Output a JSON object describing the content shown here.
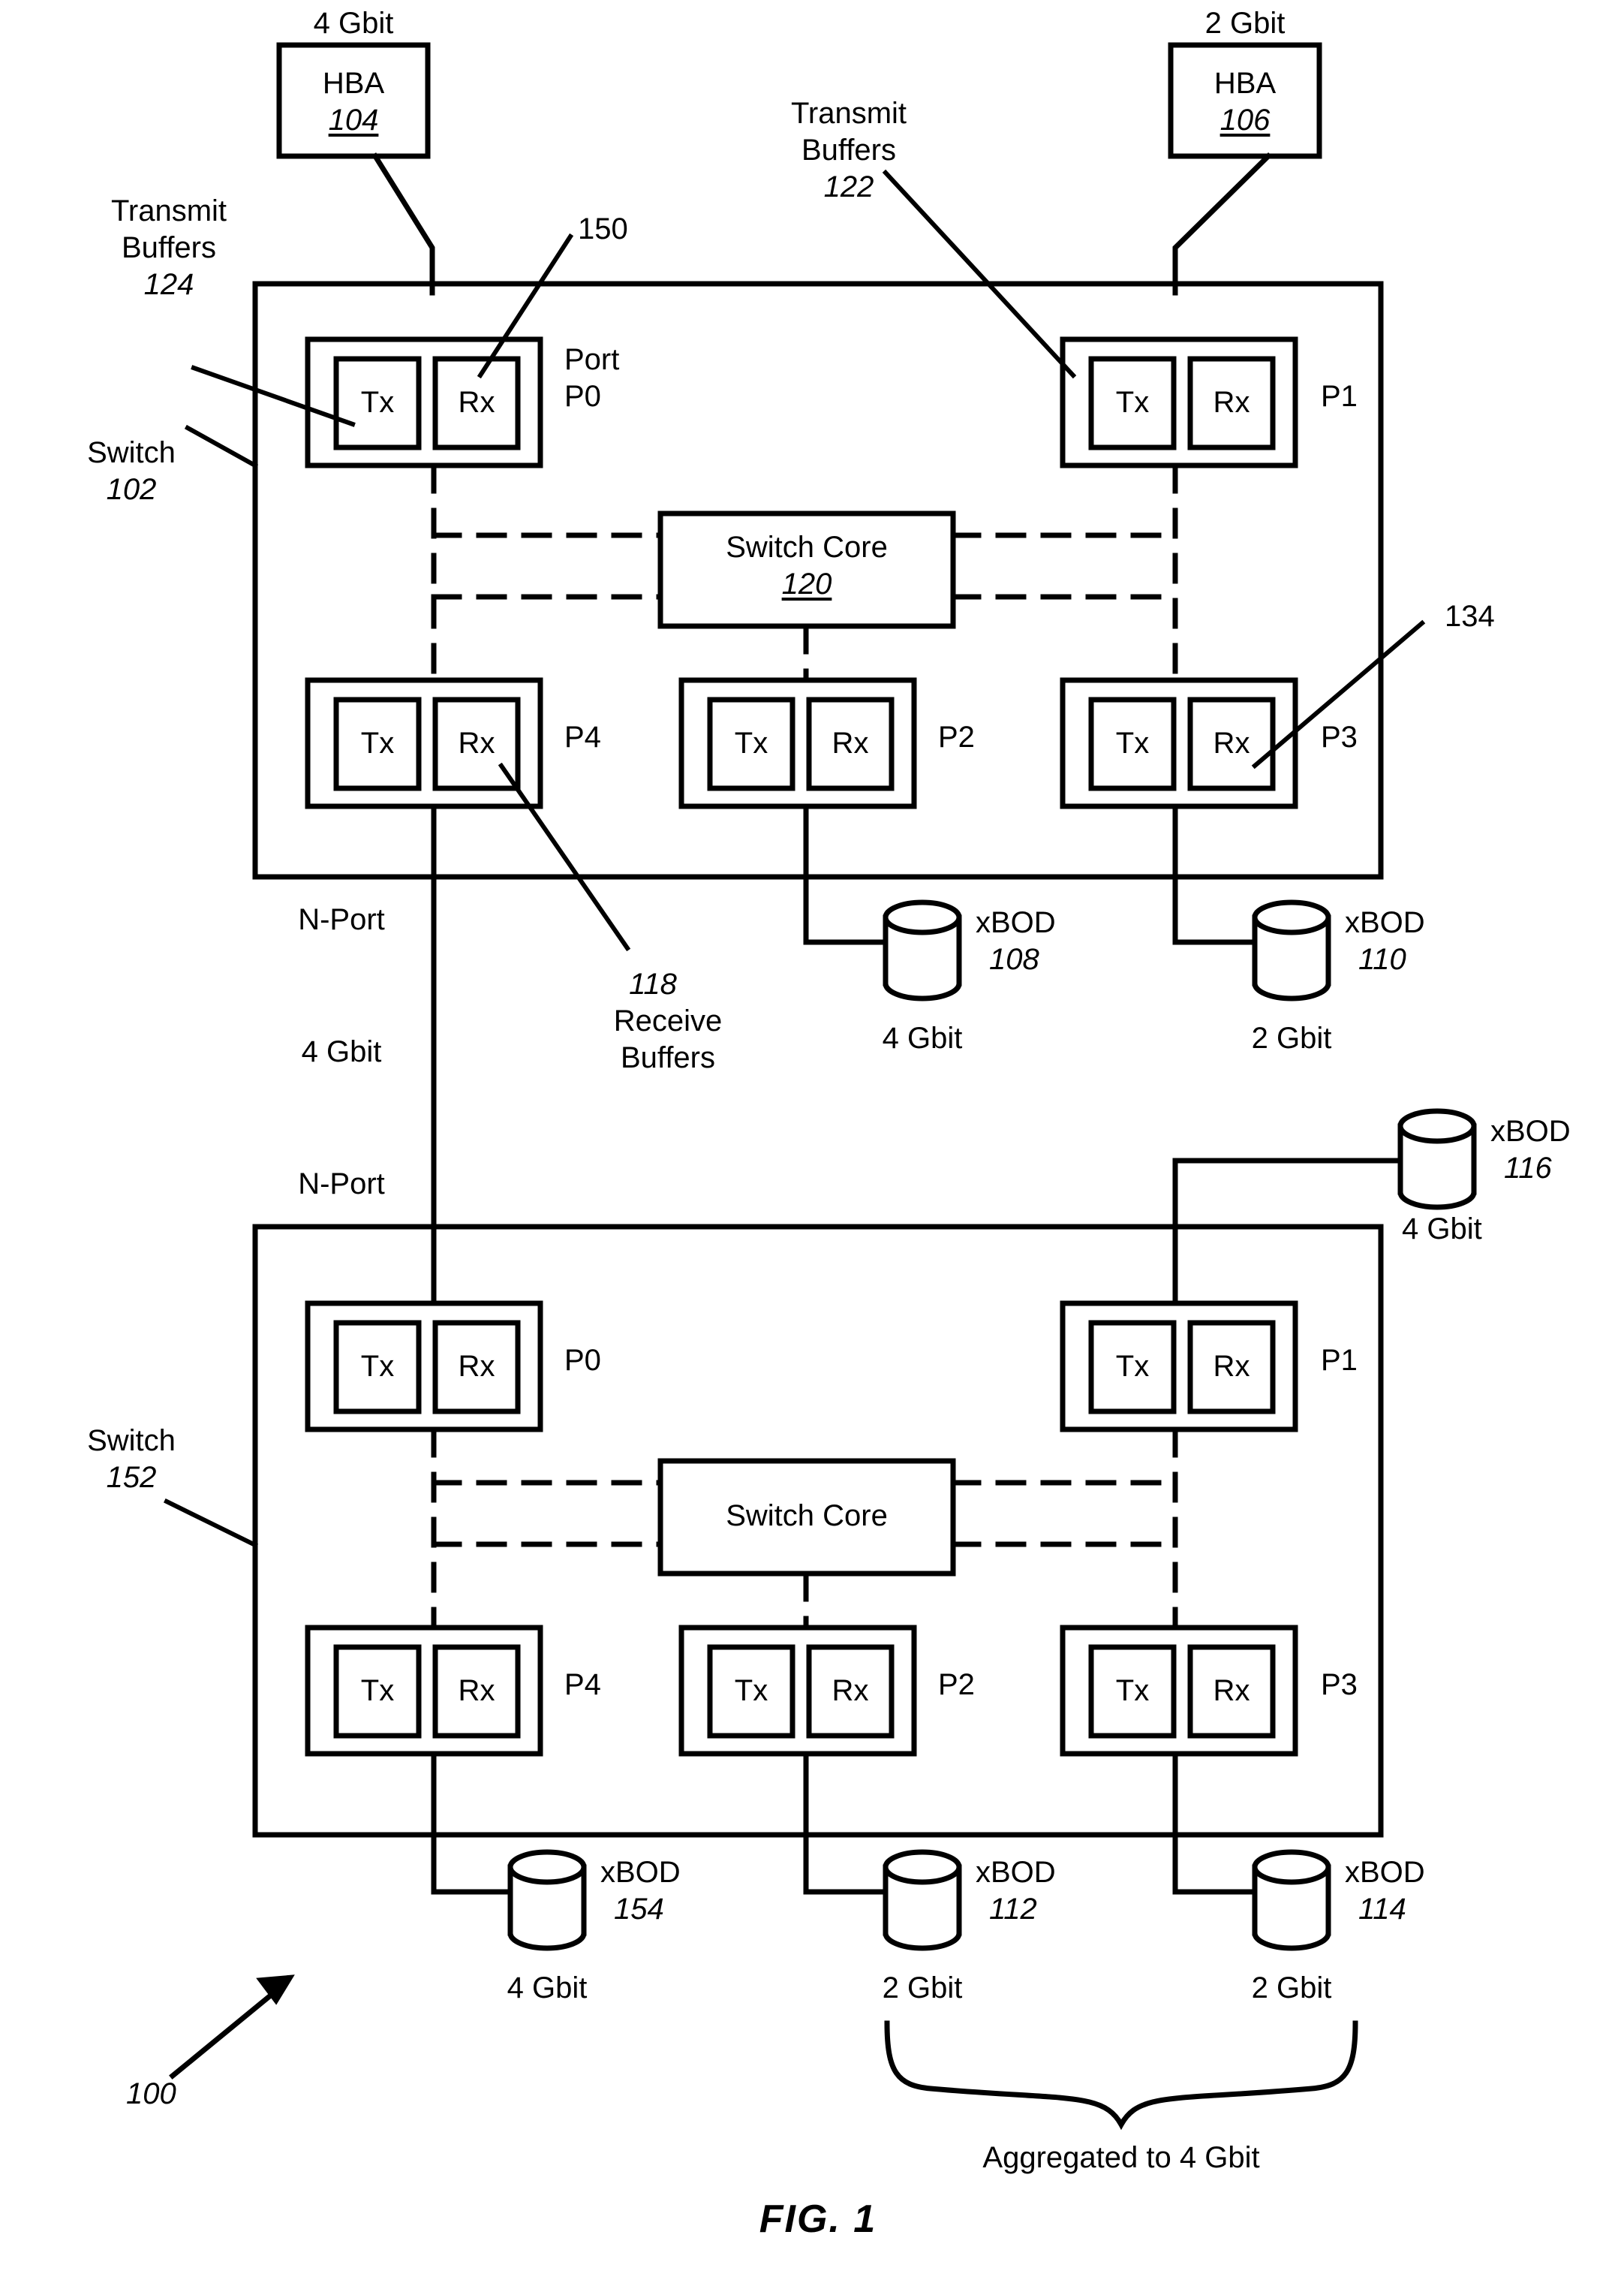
{
  "figure": {
    "caption": "FIG. 1",
    "system_ref": "100"
  },
  "hosts": [
    {
      "name": "HBA",
      "ref": "104",
      "speed": "4 Gbit"
    },
    {
      "name": "HBA",
      "ref": "106",
      "speed": "2 Gbit"
    }
  ],
  "callouts": {
    "transmit_buffers_124": {
      "line1": "Transmit",
      "line2": "Buffers",
      "ref": "124"
    },
    "transmit_buffers_122": {
      "line1": "Transmit",
      "line2": "Buffers",
      "ref": "122"
    },
    "receive_buffers_118": {
      "ref": "118",
      "line1": "Receive",
      "line2": "Buffers"
    },
    "port_150": "150",
    "port_134": "134",
    "port_label": {
      "line1": "Port",
      "line2": "P0"
    },
    "n_port_upper": "N-Port",
    "n_port_lower": "N-Port",
    "link_speed_4g": "4 Gbit",
    "aggregated": "Aggregated to 4 Gbit"
  },
  "switches": [
    {
      "name": "Switch",
      "ref": "102",
      "core": {
        "label": "Switch Core",
        "ref": "120"
      },
      "ports": [
        {
          "id": "P0",
          "tx": "Tx",
          "rx": "Rx"
        },
        {
          "id": "P1",
          "tx": "Tx",
          "rx": "Rx"
        },
        {
          "id": "P4",
          "tx": "Tx",
          "rx": "Rx"
        },
        {
          "id": "P2",
          "tx": "Tx",
          "rx": "Rx"
        },
        {
          "id": "P3",
          "tx": "Tx",
          "rx": "Rx"
        }
      ]
    },
    {
      "name": "Switch",
      "ref": "152",
      "core": {
        "label": "Switch Core",
        "ref": ""
      },
      "ports": [
        {
          "id": "P0",
          "tx": "Tx",
          "rx": "Rx"
        },
        {
          "id": "P1",
          "tx": "Tx",
          "rx": "Rx"
        },
        {
          "id": "P4",
          "tx": "Tx",
          "rx": "Rx"
        },
        {
          "id": "P2",
          "tx": "Tx",
          "rx": "Rx"
        },
        {
          "id": "P3",
          "tx": "Tx",
          "rx": "Rx"
        }
      ]
    }
  ],
  "storage": [
    {
      "name": "xBOD",
      "ref": "108",
      "speed": "4 Gbit"
    },
    {
      "name": "xBOD",
      "ref": "110",
      "speed": "2 Gbit"
    },
    {
      "name": "xBOD",
      "ref": "116",
      "speed": "4 Gbit"
    },
    {
      "name": "xBOD",
      "ref": "154",
      "speed": "4 Gbit"
    },
    {
      "name": "xBOD",
      "ref": "112",
      "speed": "2 Gbit"
    },
    {
      "name": "xBOD",
      "ref": "114",
      "speed": "2 Gbit"
    }
  ]
}
